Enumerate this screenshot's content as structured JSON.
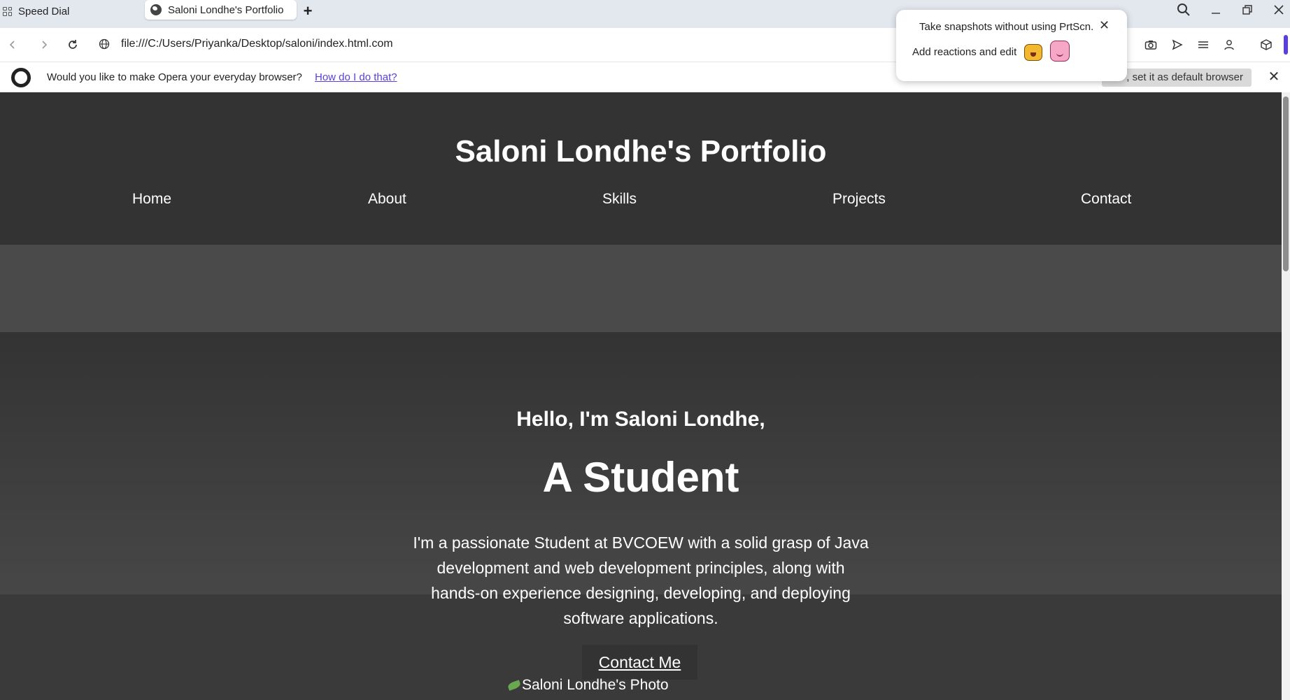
{
  "browser": {
    "tabs": [
      {
        "label": "Speed Dial",
        "icon": "speed-dial-icon"
      },
      {
        "label": "Saloni Londhe's Portfolio",
        "icon": "globe-icon",
        "active": true
      }
    ],
    "new_tab_label": "+",
    "url": "file:///C:/Users/Priyanka/Desktop/saloni/index.html.com",
    "infobar": {
      "message": "Would you like to make Opera your everyday browser?",
      "link": "How do I do that?",
      "button": ", set it as default browser"
    },
    "popup": {
      "line1": "Take snapshots without using PrtScn.",
      "line2": "Add reactions and edit"
    }
  },
  "site": {
    "title": "Saloni Londhe's Portfolio",
    "nav": [
      "Home",
      "About",
      "Skills",
      "Projects",
      "Contact"
    ],
    "hero": {
      "greeting": "Hello, I'm Saloni Londhe,",
      "role": "A Student",
      "bio": "I'm a passionate Student at BVCOEW with a solid grasp of Java development and web development principles, along with hands-on experience designing, developing, and deploying software applications.",
      "cta": "Contact Me",
      "photo_alt": "Saloni Londhe's Photo"
    }
  },
  "colors": {
    "header_bg": "#333333",
    "band_bg": "#4a4a4a",
    "text": "#ffffff",
    "link": "#5b3ee0",
    "accent_bar": "#5b3ee0"
  }
}
